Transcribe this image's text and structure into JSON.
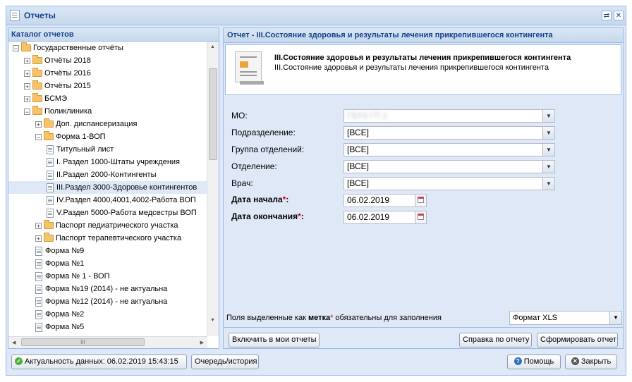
{
  "window": {
    "title": "Отчеты"
  },
  "catalog": {
    "title": "Каталог отчетов",
    "items": [
      {
        "label": "Государственные отчёты",
        "icon": "folder-open-icon",
        "expander": "−"
      },
      {
        "label": "Отчёты 2018",
        "icon": "folder-icon",
        "expander": "+"
      },
      {
        "label": "Отчёты 2016",
        "icon": "folder-icon",
        "expander": "+"
      },
      {
        "label": "Отчёты 2015",
        "icon": "folder-icon",
        "expander": "+"
      },
      {
        "label": "БСМЭ",
        "icon": "folder-icon",
        "expander": "+"
      },
      {
        "label": "Поликлиника",
        "icon": "folder-open-icon",
        "expander": "−"
      },
      {
        "label": "Доп. диспансеризация",
        "icon": "folder-icon",
        "expander": "+"
      },
      {
        "label": "Форма 1-ВОП",
        "icon": "folder-open-icon",
        "expander": "−"
      },
      {
        "label": "Титульный лист",
        "icon": "report-doc-icon"
      },
      {
        "label": "I. Раздел 1000-Штаты учреждения",
        "icon": "report-doc-icon"
      },
      {
        "label": "II.Раздел 2000-Контингенты",
        "icon": "report-doc-icon"
      },
      {
        "label": "III.Раздел 3000-Здоровье контингентов",
        "icon": "report-doc-icon"
      },
      {
        "label": "IV.Раздел 4000,4001,4002-Работа ВОП",
        "icon": "report-doc-icon"
      },
      {
        "label": "V.Раздел 5000-Работа медсестры ВОП",
        "icon": "report-doc-icon"
      },
      {
        "label": "Паспорт педиатрического участка",
        "icon": "folder-icon",
        "expander": "+"
      },
      {
        "label": "Паспорт терапевтического участка",
        "icon": "folder-icon",
        "expander": "+"
      },
      {
        "label": "Форма №9",
        "icon": "report-doc-icon"
      },
      {
        "label": "Форма №1",
        "icon": "report-doc-icon"
      },
      {
        "label": "Форма № 1 - ВОП",
        "icon": "report-doc-icon"
      },
      {
        "label": "Форма №19 (2014) - не актуальна",
        "icon": "report-doc-icon"
      },
      {
        "label": "Форма №12 (2014) - не актуальна",
        "icon": "report-doc-icon"
      },
      {
        "label": "Форма №2",
        "icon": "report-doc-icon"
      },
      {
        "label": "Форма №5",
        "icon": "report-doc-icon"
      }
    ],
    "selected": "III.Раздел 3000-Здоровье контингентов",
    "hscroll_grip": "III"
  },
  "report": {
    "header": "Отчет - III.Состояние здоровья и результаты лечения прикрепившегося контингента",
    "title": "III.Состояние здоровья и результаты лечения прикрепившегося контингента",
    "subtitle": "III.Состояние здоровья и результаты лечения прикрепившегося контингента",
    "fields": {
      "mo": {
        "label": "МО:",
        "value": "ГБУЗ ГП 1"
      },
      "subdivision": {
        "label": "Подразделение:",
        "value": "[ВСЕ]"
      },
      "dept_group": {
        "label": "Группа отделений:",
        "value": "[ВСЕ]"
      },
      "department": {
        "label": "Отделение:",
        "value": "[ВСЕ]"
      },
      "doctor": {
        "label": "Врач:",
        "value": "[ВСЕ]"
      },
      "date_start": {
        "label": "Дата начала",
        "value": "06.02.2019"
      },
      "date_end": {
        "label": "Дата окончания",
        "value": "06.02.2019"
      }
    },
    "required_mark": "*",
    "required_note": {
      "pre": "Поля выделенные как",
      "mark": "метка",
      "post": "обязательны для заполнения"
    },
    "format": "Формат XLS",
    "buttons": {
      "add": "Включить в мои отчеты",
      "help": "Справка по отчету",
      "generate": "Сформировать отчет"
    }
  },
  "footer": {
    "freshness": "Актуальность данных: 06.02.2019 15:43:15",
    "queue": "Очередь/история",
    "help": "Помощь",
    "close": "Закрыть"
  }
}
